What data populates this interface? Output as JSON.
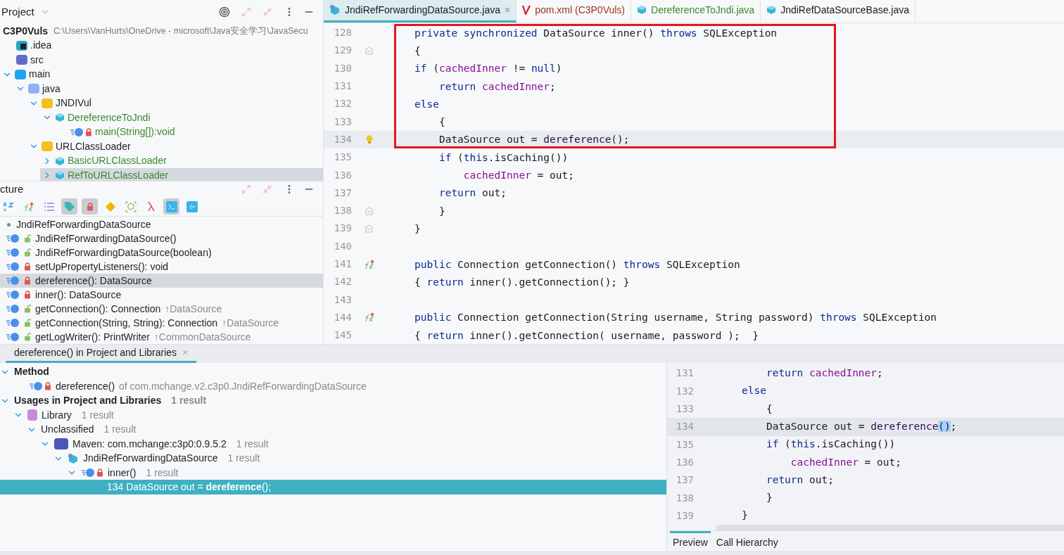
{
  "project_panel": {
    "title": "Project",
    "tree": [
      {
        "label": "C3P0Vuls",
        "detail": "C:\\Users\\VanHurts\\OneDrive - microsoft\\Java安全学习\\JavaSecu",
        "kind": "project",
        "selected": false,
        "children": [
          {
            "label": ".idea",
            "kind": "idea",
            "selected": false
          },
          {
            "label": "src",
            "kind": "src",
            "selected": false
          },
          {
            "label": "main",
            "kind": "folder-blue",
            "expanded": true,
            "selected": false,
            "children": [
              {
                "label": "java",
                "kind": "folder-light",
                "expanded": true,
                "selected": false,
                "children": [
                  {
                    "label": "JNDIVul",
                    "kind": "package",
                    "expanded": true,
                    "selected": false,
                    "children": [
                      {
                        "label": "DereferenceToJndi",
                        "kind": "class",
                        "color": "#3a8a2e",
                        "expanded": true,
                        "selected": false,
                        "children": [
                          {
                            "label": "main(String[]):void",
                            "kind": "method",
                            "color": "#3a8a2e",
                            "selected": false
                          }
                        ]
                      }
                    ]
                  },
                  {
                    "label": "URLClassLoader",
                    "kind": "package",
                    "expanded": true,
                    "selected": false,
                    "children": [
                      {
                        "label": "BasicURLClassLoader",
                        "kind": "class",
                        "color": "#3a8a2e",
                        "expanded": false,
                        "selected": false
                      },
                      {
                        "label": "RefToURLClassLoader",
                        "kind": "class",
                        "color": "#3a8a2e",
                        "expanded": false,
                        "selected": true
                      }
                    ]
                  }
                ]
              }
            ]
          }
        ]
      }
    ]
  },
  "structure_panel": {
    "title": "cture",
    "toolbar": [
      {
        "kind": "sort",
        "on": false
      },
      {
        "kind": "override",
        "on": false
      },
      {
        "kind": "list",
        "on": false
      },
      {
        "kind": "tag",
        "on": true
      },
      {
        "kind": "lock",
        "on": true
      },
      {
        "kind": "diamond",
        "on": false
      },
      {
        "kind": "anon",
        "on": false
      },
      {
        "kind": "lambda",
        "on": false
      },
      {
        "kind": "scroll-to",
        "on": true
      },
      {
        "kind": "scroll-from",
        "on": false
      }
    ],
    "root": "JndiRefForwardingDataSource",
    "members": [
      {
        "label": "JndiRefForwardingDataSource()",
        "kind": "public",
        "selected": false
      },
      {
        "label": "JndiRefForwardingDataSource(boolean)",
        "kind": "public",
        "selected": false
      },
      {
        "label": "setUpPropertyListeners(): void",
        "kind": "private",
        "selected": false
      },
      {
        "label": "dereference(): DataSource",
        "kind": "private",
        "selected": true
      },
      {
        "label": "inner(): DataSource",
        "kind": "private",
        "selected": false
      },
      {
        "label": "getConnection(): Connection",
        "inherited": "↑DataSource",
        "kind": "public",
        "selected": false
      },
      {
        "label": "getConnection(String, String): Connection",
        "inherited": "↑DataSource",
        "kind": "public",
        "selected": false
      },
      {
        "label": "getLogWriter(): PrintWriter",
        "inherited": "↑CommonDataSource",
        "kind": "public",
        "selected": false
      }
    ]
  },
  "editor": {
    "tabs": [
      {
        "label": "JndiRefForwardingDataSource.java",
        "kind": "library-class",
        "color": "#1a1a1a",
        "close": "×",
        "selected": true
      },
      {
        "label": "pom.xml (C3P0Vuls)",
        "kind": "maven",
        "color": "#a0361c",
        "selected": false
      },
      {
        "label": "DereferenceToJndi.java",
        "kind": "class",
        "color": "#3a8a2e",
        "selected": false
      },
      {
        "label": "JndiRefDataSourceBase.java",
        "kind": "class",
        "color": "#1a1a1a",
        "selected": false
      }
    ],
    "lines": [
      {
        "number": "128",
        "kind": "plain",
        "boxed": true,
        "current": false,
        "tokens": [
          {
            "kind": "keyword",
            "text": "private synchronized"
          },
          {
            "kind": "plain",
            "text": " DataSource inner() "
          },
          {
            "kind": "keyword",
            "text": "throws"
          },
          {
            "kind": "plain",
            "text": " SQLException"
          }
        ]
      },
      {
        "number": "129",
        "kind": "fold",
        "boxed": true,
        "current": false,
        "tokens": [
          {
            "kind": "plain",
            "text": "{"
          }
        ]
      },
      {
        "number": "130",
        "kind": "plain",
        "boxed": true,
        "current": false,
        "tokens": [
          {
            "kind": "keyword",
            "text": "if"
          },
          {
            "kind": "plain",
            "text": " ("
          },
          {
            "kind": "field",
            "text": "cachedInner"
          },
          {
            "kind": "plain",
            "text": " != "
          },
          {
            "kind": "keyword",
            "text": "null"
          },
          {
            "kind": "plain",
            "text": ")"
          }
        ]
      },
      {
        "number": "131",
        "kind": "plain",
        "boxed": true,
        "current": false,
        "tokens": [
          {
            "kind": "keyword",
            "text": "    return "
          },
          {
            "kind": "field",
            "text": "cachedInner"
          },
          {
            "kind": "plain",
            "text": ";"
          }
        ]
      },
      {
        "number": "132",
        "kind": "plain",
        "boxed": true,
        "current": false,
        "tokens": [
          {
            "kind": "keyword",
            "text": "else"
          }
        ]
      },
      {
        "number": "133",
        "kind": "plain",
        "boxed": true,
        "current": false,
        "tokens": [
          {
            "kind": "plain",
            "text": "    {"
          }
        ]
      },
      {
        "number": "134",
        "kind": "bulb",
        "boxed": true,
        "current": true,
        "tokens": [
          {
            "kind": "plain",
            "text": "    DataSource out = "
          },
          {
            "kind": "usage",
            "text": "dereference"
          },
          {
            "kind": "plain",
            "text": "();"
          }
        ]
      },
      {
        "number": "135",
        "kind": "plain",
        "boxed": false,
        "current": false,
        "tokens": [
          {
            "kind": "keyword",
            "text": "    if"
          },
          {
            "kind": "plain",
            "text": " ("
          },
          {
            "kind": "keyword",
            "text": "this"
          },
          {
            "kind": "plain",
            "text": ".isCaching())"
          }
        ]
      },
      {
        "number": "136",
        "kind": "plain",
        "boxed": false,
        "current": false,
        "tokens": [
          {
            "kind": "field",
            "text": "        cachedInner"
          },
          {
            "kind": "plain",
            "text": " = out;"
          }
        ]
      },
      {
        "number": "137",
        "kind": "plain",
        "boxed": false,
        "current": false,
        "tokens": [
          {
            "kind": "keyword",
            "text": "    return"
          },
          {
            "kind": "plain",
            "text": " out;"
          }
        ]
      },
      {
        "number": "138",
        "kind": "fold",
        "boxed": false,
        "current": false,
        "tokens": [
          {
            "kind": "plain",
            "text": "    }"
          }
        ]
      },
      {
        "number": "139",
        "kind": "fold",
        "boxed": false,
        "current": false,
        "tokens": [
          {
            "kind": "plain",
            "text": "}"
          }
        ]
      },
      {
        "number": "140",
        "kind": "plain",
        "boxed": false,
        "current": false
      },
      {
        "number": "141",
        "kind": "override",
        "boxed": false,
        "current": false,
        "tokens": [
          {
            "kind": "keyword",
            "text": "public"
          },
          {
            "kind": "plain",
            "text": " Connection getConnection() "
          },
          {
            "kind": "keyword",
            "text": "throws"
          },
          {
            "kind": "plain",
            "text": " SQLException"
          }
        ]
      },
      {
        "number": "142",
        "kind": "plain",
        "boxed": false,
        "current": false,
        "tokens": [
          {
            "kind": "plain",
            "text": "{ "
          },
          {
            "kind": "keyword",
            "text": "return"
          },
          {
            "kind": "plain",
            "text": " inner().getConnection(); }"
          }
        ]
      },
      {
        "number": "143",
        "kind": "plain",
        "boxed": false,
        "current": false
      },
      {
        "number": "144",
        "kind": "override",
        "boxed": false,
        "current": false,
        "tokens": [
          {
            "kind": "keyword",
            "text": "public"
          },
          {
            "kind": "plain",
            "text": " Connection getConnection(String username, String password) "
          },
          {
            "kind": "keyword",
            "text": "throws"
          },
          {
            "kind": "plain",
            "text": " SQLException"
          }
        ]
      },
      {
        "number": "145",
        "kind": "plain",
        "boxed": false,
        "current": false,
        "tokens": [
          {
            "kind": "plain",
            "text": "{ "
          },
          {
            "kind": "keyword",
            "text": "return"
          },
          {
            "kind": "plain",
            "text": " inner().getConnection( username, password );  }"
          }
        ]
      }
    ]
  },
  "find_panel": {
    "tab": {
      "label": "dereference() in Project and Libraries",
      "close": "×",
      "selected": true
    },
    "tree": [
      {
        "label": "Method",
        "kind": "group",
        "expanded": true,
        "selected": false,
        "children": [
          {
            "label": "dereference()",
            "detail": "of com.mchange.v2.c3p0.JndiRefForwardingDataSource",
            "kind": "method",
            "selected": false
          }
        ]
      },
      {
        "label": "Usages in Project and Libraries",
        "count": "1 result",
        "kind": "group",
        "expanded": true,
        "selected": false,
        "children": [
          {
            "label": "Library",
            "count": "1 result",
            "kind": "library",
            "expanded": true,
            "selected": false,
            "children": [
              {
                "label": "Unclassified",
                "count": "1 result",
                "expanded": true,
                "selected": false,
                "children": [
                  {
                    "label": "Maven: com.mchange:c3p0:0.9.5.2",
                    "count": "1 result",
                    "kind": "module",
                    "expanded": true,
                    "selected": false,
                    "children": [
                      {
                        "label": "JndiRefForwardingDataSource",
                        "count": "1 result",
                        "kind": "class",
                        "expanded": true,
                        "selected": false,
                        "children": [
                          {
                            "label": "inner()",
                            "count": "1 result",
                            "kind": "method",
                            "expanded": true,
                            "selected": false,
                            "children": [
                              {
                                "label": "134 DataSource out = **dereference**();",
                                "kind": "usage",
                                "selected": true
                              }
                            ]
                          }
                        ]
                      }
                    ]
                  }
                ]
              }
            ]
          }
        ]
      }
    ],
    "preview": {
      "lines": [
        {
          "number": "131",
          "current": false,
          "tokens": [
            {
              "kind": "keyword",
              "text": "    return "
            },
            {
              "kind": "field",
              "text": "cachedInner"
            },
            {
              "kind": "plain",
              "text": ";"
            }
          ]
        },
        {
          "number": "132",
          "current": false,
          "tokens": [
            {
              "kind": "keyword",
              "text": "else"
            }
          ]
        },
        {
          "number": "133",
          "current": false,
          "tokens": [
            {
              "kind": "plain",
              "text": "    {"
            }
          ]
        },
        {
          "number": "134",
          "current": true,
          "tokens": [
            {
              "kind": "plain",
              "text": "    DataSource out = "
            },
            {
              "kind": "usage",
              "text": "dereference"
            },
            {
              "kind": "match",
              "text": "()"
            },
            {
              "kind": "plain",
              "text": ";"
            }
          ]
        },
        {
          "number": "135",
          "current": false,
          "tokens": [
            {
              "kind": "keyword",
              "text": "    if"
            },
            {
              "kind": "plain",
              "text": " ("
            },
            {
              "kind": "keyword",
              "text": "this"
            },
            {
              "kind": "plain",
              "text": ".isCaching())"
            }
          ]
        },
        {
          "number": "136",
          "current": false,
          "tokens": [
            {
              "kind": "field",
              "text": "        cachedInner"
            },
            {
              "kind": "plain",
              "text": " = out;"
            }
          ]
        },
        {
          "number": "137",
          "current": false,
          "tokens": [
            {
              "kind": "keyword",
              "text": "    return"
            },
            {
              "kind": "plain",
              "text": " out;"
            }
          ]
        },
        {
          "number": "138",
          "current": false,
          "tokens": [
            {
              "kind": "plain",
              "text": "    }"
            }
          ]
        },
        {
          "number": "139",
          "current": false,
          "tokens": [
            {
              "kind": "plain",
              "text": "}"
            }
          ]
        }
      ],
      "tabs": [
        {
          "label": "Preview",
          "selected": true
        },
        {
          "label": "Call Hierarchy",
          "selected": false
        }
      ]
    }
  }
}
